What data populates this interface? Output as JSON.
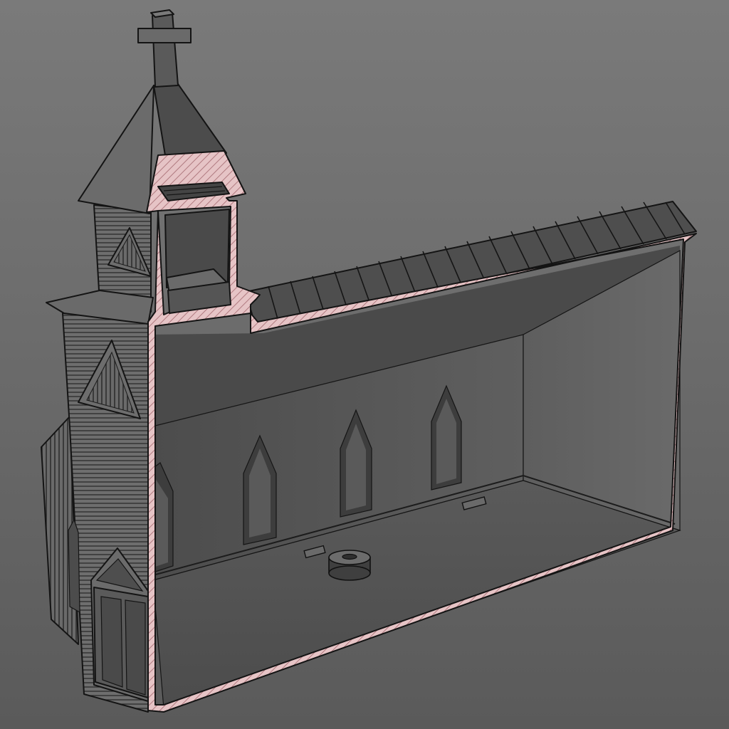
{
  "viewport": {
    "background_top": "#7a7a7a",
    "background_bottom": "#5a5a5a"
  },
  "model": {
    "subject": "church-section-view",
    "section_fill_color": "#e6c4c6",
    "section_hatch_color": "#b07a80",
    "wall_color": "#575757",
    "roof_color": "#4e4e4e",
    "floor_color": "#535353",
    "edge_color": "#141414",
    "icons": [
      "cross-icon"
    ]
  }
}
